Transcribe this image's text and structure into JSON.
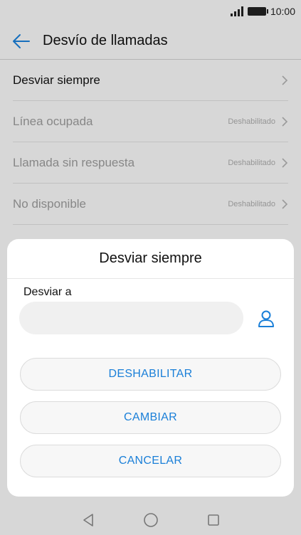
{
  "status_bar": {
    "time": "10:00"
  },
  "app_bar": {
    "title": "Desvío de llamadas"
  },
  "list": {
    "items": [
      {
        "label": "Desviar siempre",
        "status": "",
        "enabled": true
      },
      {
        "label": "Línea ocupada",
        "status": "Deshabilitado",
        "enabled": false
      },
      {
        "label": "Llamada sin respuesta",
        "status": "Deshabilitado",
        "enabled": false
      },
      {
        "label": "No disponible",
        "status": "Deshabilitado",
        "enabled": false
      }
    ]
  },
  "dialog": {
    "title": "Desviar siempre",
    "field_label": "Desviar a",
    "input_value": "",
    "buttons": {
      "disable": "DESHABILITAR",
      "change": "CAMBIAR",
      "cancel": "CANCELAR"
    }
  },
  "colors": {
    "accent": "#1a7fd8",
    "disabled_text": "#9a9a9a"
  },
  "icons": {
    "back": "arrow-left-icon",
    "chevron": "chevron-right-icon",
    "contact": "person-icon",
    "nav_back": "triangle-back-icon",
    "nav_home": "circle-home-icon",
    "nav_recents": "square-recents-icon"
  }
}
